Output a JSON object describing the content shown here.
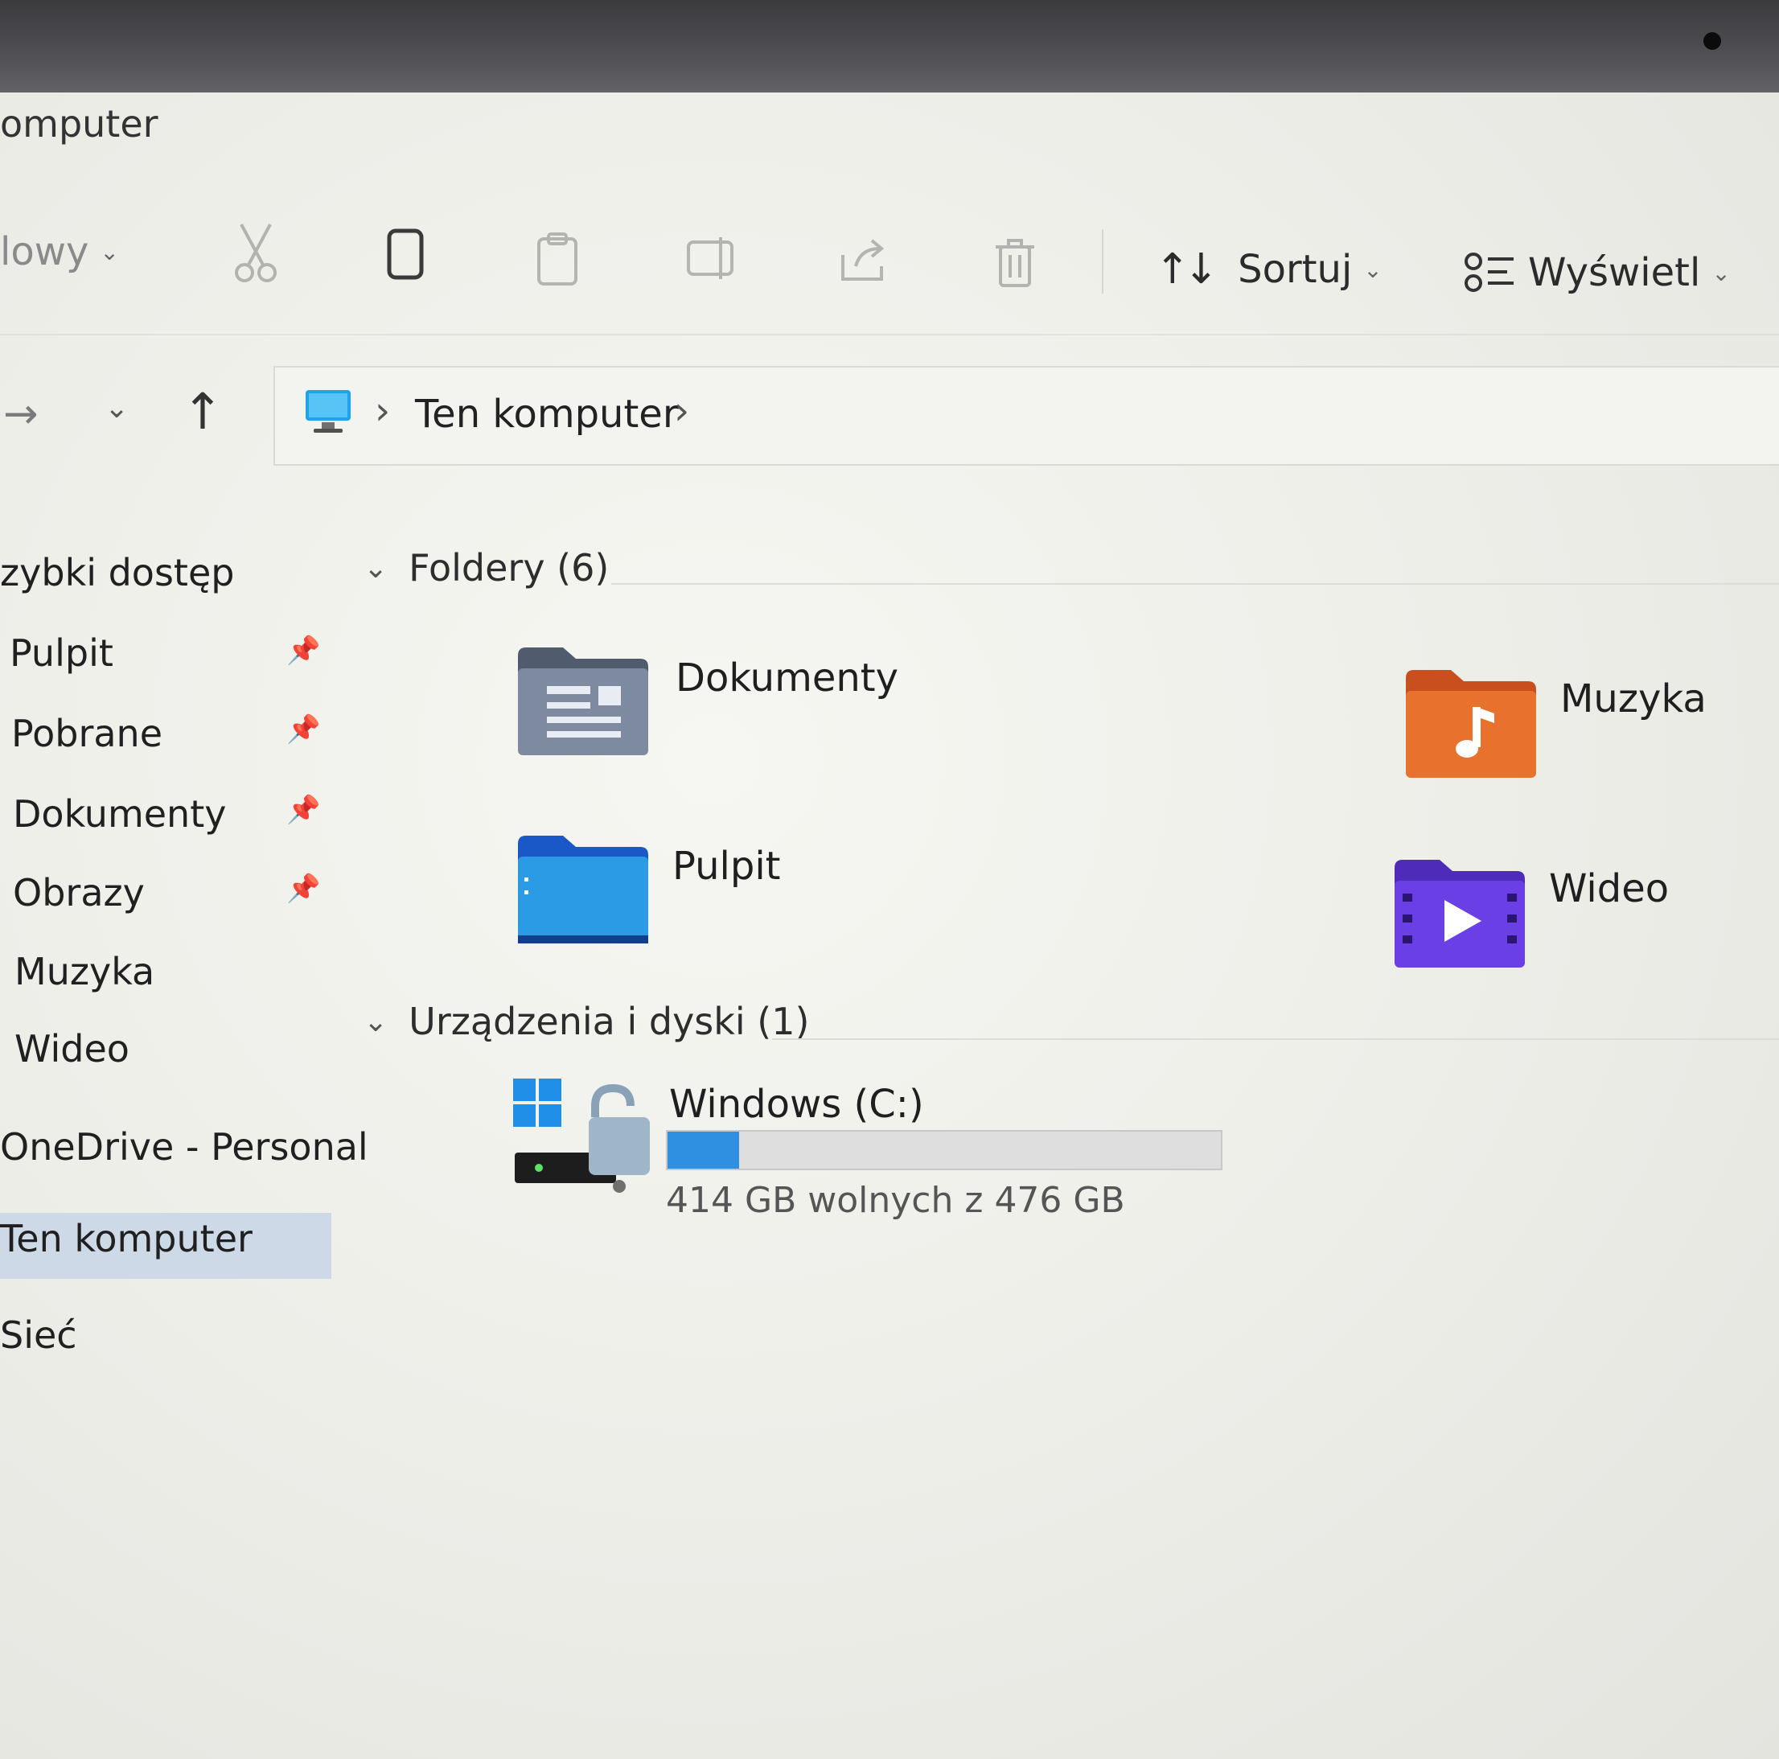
{
  "window": {
    "title_partial": "omputer"
  },
  "toolbar": {
    "new_label": "lowy",
    "sort_label": "Sortuj",
    "view_label": "Wyświetl",
    "icons": [
      "cut-icon",
      "copy-icon",
      "paste-icon",
      "rename-icon",
      "share-icon",
      "delete-icon"
    ]
  },
  "nav": {
    "address": [
      "Ten komputer"
    ]
  },
  "sidebar": {
    "quick_access": "zybki dostęp",
    "items": [
      {
        "label": "Pulpit",
        "pinned": true
      },
      {
        "label": "Pobrane",
        "pinned": true
      },
      {
        "label": "Dokumenty",
        "pinned": true
      },
      {
        "label": "Obrazy",
        "pinned": true
      },
      {
        "label": "Muzyka",
        "pinned": false
      },
      {
        "label": "Wideo",
        "pinned": false
      }
    ],
    "onedrive": "OneDrive - Personal",
    "this_pc": "Ten komputer",
    "network": "Sieć"
  },
  "main": {
    "folders_header": "Foldery (6)",
    "folders": [
      {
        "label": "Dokumenty",
        "icon": "documents-folder-icon"
      },
      {
        "label": "Muzyka",
        "icon": "music-folder-icon"
      },
      {
        "label": "Pulpit",
        "icon": "desktop-folder-icon"
      },
      {
        "label": "Wideo",
        "icon": "video-folder-icon"
      }
    ],
    "devices_header": "Urządzenia i dyski (1)",
    "drive": {
      "label": "Windows (C:)",
      "free_text": "414 GB wolnych z 476 GB",
      "used_fraction": 0.13
    }
  },
  "colors": {
    "accent": "#2f8fe0",
    "selected_bg": "#cdd9e6"
  }
}
